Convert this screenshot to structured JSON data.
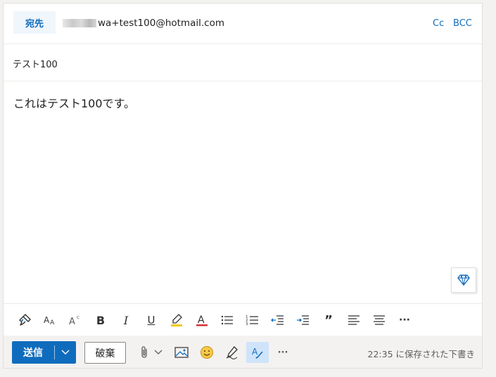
{
  "header": {
    "to_label": "宛先",
    "recipient": "wa+test100@hotmail.com",
    "cc_label": "Cc",
    "bcc_label": "BCC"
  },
  "subject": "テスト100",
  "body": "これはテスト100です。",
  "format_toolbar": {
    "icons": [
      "format-painter-icon",
      "font-size-icon",
      "superscript-icon",
      "bold-icon",
      "italic-icon",
      "underline-icon",
      "highlight-icon",
      "font-color-icon",
      "bullets-icon",
      "numbering-icon",
      "decrease-indent-icon",
      "increase-indent-icon",
      "quote-icon",
      "align-left-icon",
      "align-center-icon",
      "more-options-icon"
    ],
    "bold_glyph": "B",
    "italic_glyph": "I",
    "underline_glyph": "U",
    "quote_glyph": "”",
    "more_glyph": "···"
  },
  "actions": {
    "send_label": "送信",
    "discard_label": "破棄",
    "more_glyph": "···",
    "saved_status": "22:35 に保存された下書き"
  },
  "colors": {
    "accent": "#0f6cbd",
    "highlight": "#f2c811",
    "font_color_bar": "#d13438",
    "active_bg": "#cfe4fa"
  }
}
